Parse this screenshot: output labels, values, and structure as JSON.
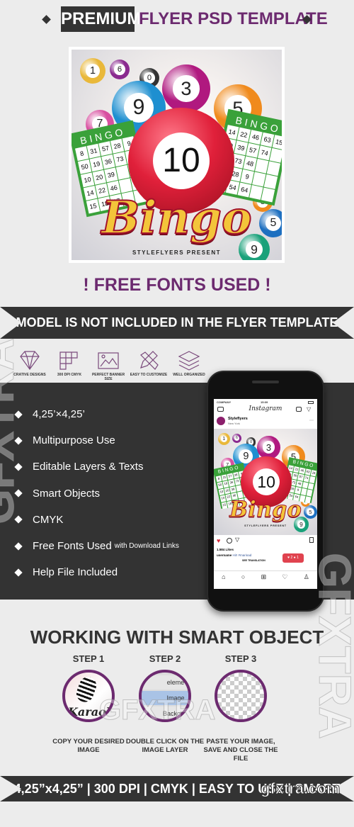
{
  "header": {
    "badge": "PREMIUM",
    "title": "FLYER PSD TEMPLATE"
  },
  "flyer": {
    "headline": "Bingo",
    "presenter": "STYLEFLYERS PRESENT",
    "main_ball": "10",
    "balls": [
      "1",
      "6",
      "0",
      "9",
      "3",
      "5",
      "7",
      "5",
      "9",
      "8"
    ],
    "card_title": "BINGO",
    "left_card": [
      "8",
      "31",
      "57",
      "28",
      "9",
      "50",
      "19",
      "36",
      "73",
      "",
      "10",
      "20",
      "39",
      "",
      "",
      "14",
      "22",
      "46",
      "",
      "",
      "15",
      "18",
      "37",
      "",
      ""
    ],
    "right_card": [
      "14",
      "22",
      "46",
      "63",
      "15",
      "20",
      "39",
      "57",
      "74",
      "",
      "36",
      "73",
      "48",
      "",
      "",
      "57",
      "28",
      "9",
      "",
      "",
      "7",
      "54",
      "64",
      "",
      ""
    ]
  },
  "free_fonts": "! FREE FONTS USED !",
  "ribbon_top": "MODEL IS NOT INCLUDED  IN THE FLYER TEMPLATE",
  "features": [
    {
      "label": "CRATIVE DESIGNS",
      "icon": "diamond-icon"
    },
    {
      "label": "300 DPI CMYK",
      "icon": "grid-icon"
    },
    {
      "label": "PERFECT BANNER SIZE",
      "icon": "image-icon"
    },
    {
      "label": "EASY TO CUSTOMIZE",
      "icon": "pencil-ruler-icon"
    },
    {
      "label": "WELL ORGANIZED",
      "icon": "layers-icon"
    }
  ],
  "list": [
    {
      "text": "4,25’×4,25’"
    },
    {
      "text": "Multipurpose Use"
    },
    {
      "text": "Editable Layers & Texts"
    },
    {
      "text": "Smart Objects"
    },
    {
      "text": "CMYK"
    },
    {
      "text": "Free Fonts Used",
      "note": "with Download Links"
    },
    {
      "text": "Help File Included"
    }
  ],
  "phone": {
    "carrier": "COMPANY",
    "time": "15:09",
    "app": "Instagram",
    "account": "Styleflyers",
    "location": "New York",
    "likes": "1.584 Likes",
    "caption_user": "username",
    "caption": "Hi!! #marinad",
    "see_translation": "SEE TRANSLATION",
    "notif_likes": "2",
    "notif_follows": "1"
  },
  "working_title": "WORKING WITH SMART OBJECT",
  "steps": [
    {
      "label": "STEP 1",
      "caption": "COPY YOUR DESIRED IMAGE",
      "art": "Karaoke"
    },
    {
      "label": "STEP 2",
      "caption": "DOUBLE CLICK ON THE IMAGE LAYER",
      "layers": [
        "eleme",
        "Image",
        "Backgrou"
      ]
    },
    {
      "label": "STEP 3",
      "caption": "PASTE YOUR IMAGE, SAVE AND CLOSE THE FILE"
    }
  ],
  "ribbon_bottom": "4,25”x4,25”  |  300 DPI  |  CMYK  |  EASY TO USE  |  SMART OBJECTS",
  "watermark": {
    "text": "GFXTRA",
    "site": "gfxtra.com"
  },
  "colors": {
    "purple": "#6c2a6f",
    "dark": "#333333",
    "bg": "#ececec"
  }
}
